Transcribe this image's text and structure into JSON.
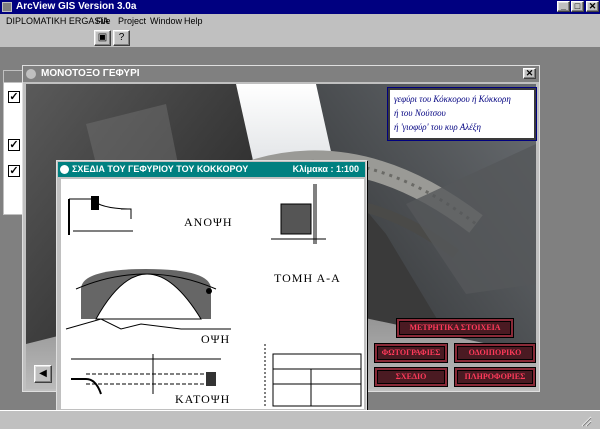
{
  "app": {
    "title": "ArcView GIS Version 3.0a",
    "window_buttons": {
      "minimize": "_",
      "maximize": "□",
      "close": "✕"
    }
  },
  "menu": {
    "items": [
      "DIPLOMATIKH ERGASIA",
      "File",
      "Project",
      "Window",
      "Help"
    ]
  },
  "toolbar": {
    "buttons": [
      {
        "icon": "save-icon",
        "glyph": "▣"
      },
      {
        "icon": "help-cursor-icon",
        "glyph": "?"
      }
    ]
  },
  "project_window": {
    "checks": [
      "✓",
      "✓",
      "✓"
    ]
  },
  "photo_window": {
    "title": "ΜΟΝΟΤΟΞΟ ΓΕΦΥΡΙ",
    "close": "✕",
    "caption": [
      "γεφύρι του Κόκκορου ή Κόκκορη",
      "ή του Νούτσου",
      "ή 'γιοφύρ' του κυρ Αλέξη"
    ],
    "nav_prev": "◀"
  },
  "drawing_window": {
    "title": "ΣΧΕΔΙΑ ΤΟΥ ΓΕΦΥΡΙΟΥ ΤΟΥ ΚΟΚΚΟΡΟΥ",
    "scale": "Κλίμακα : 1:100",
    "close": "✕",
    "labels": {
      "top_view": "ΑΝΟΨΗ",
      "section": "ΤΟΜΗ Α-Α",
      "elevation": "ΟΨΗ",
      "plan": "ΚΑΤΟΨΗ"
    }
  },
  "buttons": {
    "measurements": "ΜΕΤΡΗΤΙΚΑ ΣΤΟΙΧΕΙΑ",
    "photos": "ΦΩΤΟΓΡΑΦΙΕΣ",
    "itinerary": "ΟΔΟΙΠΟΡΙΚΟ",
    "drawing": "ΣΧΕΔΙΟ",
    "info": "ΠΛΗΡΟΦΟΡΙΕΣ"
  },
  "colors": {
    "active_title": "#000080",
    "drawing_title": "#008080",
    "button_text": "#ff3a5a",
    "caption_text": "#000080"
  }
}
